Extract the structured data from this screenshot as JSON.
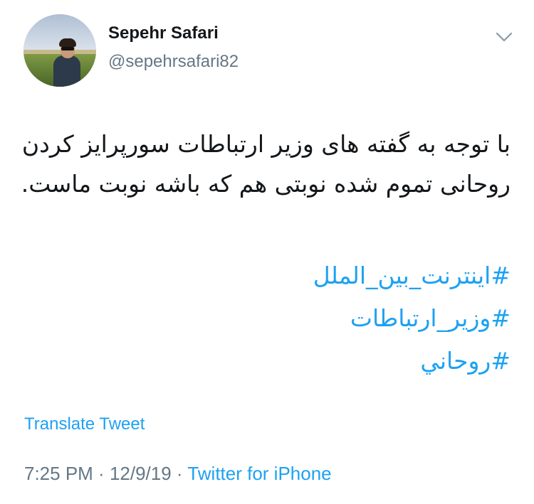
{
  "author": {
    "name": "Sepehr Safari",
    "handle": "@sepehrsafari82"
  },
  "tweet": {
    "text": "با توجه به گفته های وزیر ارتباطات سورپرایز کردن روحانی تموم شده نوبتی هم که باشه نوبت ماست.",
    "hashtags": [
      "#اینترنت_بین_الملل",
      "#وزیر_ارتباطات",
      "#روحاني"
    ]
  },
  "actions": {
    "translate_label": "Translate Tweet"
  },
  "meta": {
    "time": "7:25 PM",
    "separator1": " · ",
    "date": "12/9/19",
    "separator2": " · ",
    "source": "Twitter for iPhone"
  },
  "icons": {
    "menu": "chevron-down-icon"
  },
  "colors": {
    "link": "#1da1f2",
    "secondary": "#657786",
    "text": "#14171a"
  }
}
